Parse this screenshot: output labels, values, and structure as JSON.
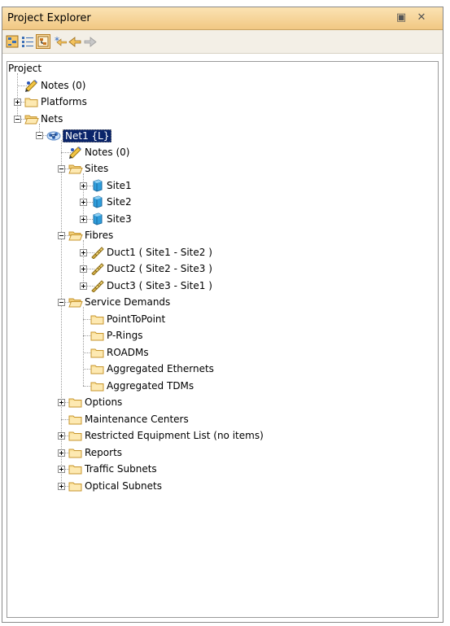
{
  "panel": {
    "title": "Project Explorer",
    "restore_glyph": "▣",
    "close_glyph": "✕"
  },
  "toolbar": {
    "buttons": [
      "expand-all-icon",
      "list-view-icon",
      "tree-view-icon",
      "asterisk-icon",
      "back-arrow-icon",
      "forward-arrow-icon"
    ]
  },
  "tree": [
    {
      "depth": 0,
      "toggle": "none",
      "icon": "none",
      "label": "Project"
    },
    {
      "depth": 1,
      "toggle": "none",
      "icon": "notes",
      "label": "Notes (0)"
    },
    {
      "depth": 1,
      "toggle": "plus",
      "icon": "folder",
      "label": "Platforms"
    },
    {
      "depth": 1,
      "toggle": "minus",
      "icon": "folder-open",
      "label": "Nets"
    },
    {
      "depth": 2,
      "toggle": "minus",
      "icon": "net",
      "label": "Net1 {L}",
      "selected": true
    },
    {
      "depth": 3,
      "toggle": "none",
      "icon": "notes",
      "label": "Notes (0)"
    },
    {
      "depth": 3,
      "toggle": "minus",
      "icon": "folder-open",
      "label": "Sites"
    },
    {
      "depth": 4,
      "toggle": "plus",
      "icon": "site",
      "label": "Site1"
    },
    {
      "depth": 4,
      "toggle": "plus",
      "icon": "site",
      "label": "Site2"
    },
    {
      "depth": 4,
      "toggle": "plus",
      "icon": "site",
      "label": "Site3"
    },
    {
      "depth": 3,
      "toggle": "minus",
      "icon": "folder-open",
      "label": "Fibres"
    },
    {
      "depth": 4,
      "toggle": "plus",
      "icon": "duct",
      "label": "Duct1 ( Site1 - Site2 )"
    },
    {
      "depth": 4,
      "toggle": "plus",
      "icon": "duct",
      "label": "Duct2 ( Site2 - Site3 )"
    },
    {
      "depth": 4,
      "toggle": "plus",
      "icon": "duct",
      "label": "Duct3 ( Site3 - Site1 )"
    },
    {
      "depth": 3,
      "toggle": "minus",
      "icon": "folder-open",
      "label": "Service Demands"
    },
    {
      "depth": 4,
      "toggle": "none",
      "icon": "folder",
      "label": "PointToPoint"
    },
    {
      "depth": 4,
      "toggle": "none",
      "icon": "folder",
      "label": "P-Rings"
    },
    {
      "depth": 4,
      "toggle": "none",
      "icon": "folder",
      "label": "ROADMs"
    },
    {
      "depth": 4,
      "toggle": "none",
      "icon": "folder",
      "label": "Aggregated Ethernets"
    },
    {
      "depth": 4,
      "toggle": "none",
      "icon": "folder",
      "label": "Aggregated TDMs"
    },
    {
      "depth": 3,
      "toggle": "plus",
      "icon": "folder",
      "label": "Options"
    },
    {
      "depth": 3,
      "toggle": "none",
      "icon": "folder",
      "label": "Maintenance Centers"
    },
    {
      "depth": 3,
      "toggle": "plus",
      "icon": "folder",
      "label": "Restricted Equipment List (no items)"
    },
    {
      "depth": 3,
      "toggle": "plus",
      "icon": "folder",
      "label": "Reports"
    },
    {
      "depth": 3,
      "toggle": "plus",
      "icon": "folder",
      "label": "Traffic Subnets"
    },
    {
      "depth": 3,
      "toggle": "plus",
      "icon": "folder",
      "label": "Optical Subnets"
    }
  ]
}
